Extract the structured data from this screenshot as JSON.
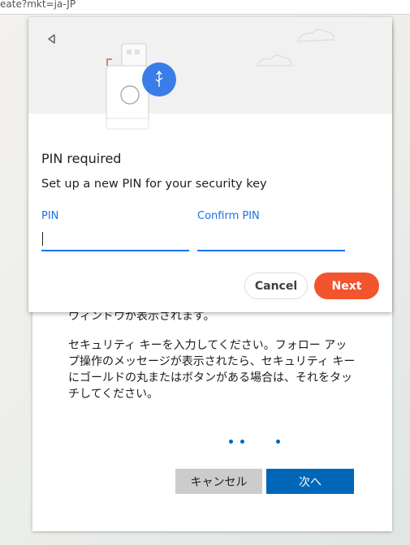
{
  "browser": {
    "url_fragment": "eate?mkt=ja-JP"
  },
  "ms_card": {
    "text_line1": "ウィンドウが表示されます。",
    "text_paragraph": "セキュリティ キーを入力してください。フォロー アップ操作のメッセージが表示されたら、セキュリティ キーにゴールドの丸またはボタンがある場合は、それをタッチしてください。",
    "cancel_label": "キャンセル",
    "next_label": "次へ",
    "accent_color": "#0067b8"
  },
  "dialog": {
    "back_icon": "back-triangle-icon",
    "illustration": "security-key-usb-icon",
    "title": "PIN required",
    "description": "Set up a new PIN for your security key",
    "pin_label": "PIN",
    "confirm_pin_label": "Confirm PIN",
    "pin_value": "",
    "confirm_pin_value": "",
    "cancel_label": "Cancel",
    "next_label": "Next",
    "accent_color": "#1a73e8",
    "next_color": "#f2542d"
  }
}
